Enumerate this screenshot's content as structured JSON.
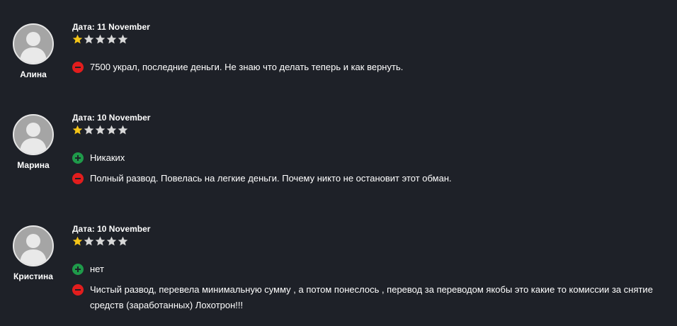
{
  "colors": {
    "background": "#1e2128",
    "star_filled": "#f5c518",
    "star_empty": "#d8d8d8",
    "minus_sign": "#e21d1d",
    "plus_sign": "#1f9a4a"
  },
  "reviews": [
    {
      "author": "Алина",
      "date": "Дата: 11 November",
      "rating": 1,
      "max_rating": 5,
      "pros": "",
      "cons": "7500 украл, последние деньги. Не знаю что делать теперь и как вернуть."
    },
    {
      "author": "Марина",
      "date": "Дата: 10 November",
      "rating": 1,
      "max_rating": 5,
      "pros": "Никаких",
      "cons": "Полный развод. Повелась на легкие деньги. Почему никто не остановит этот обман."
    },
    {
      "author": "Кристина",
      "date": "Дата: 10 November",
      "rating": 1,
      "max_rating": 5,
      "pros": "нет",
      "cons": "Чистый развод, перевела минимальную сумму , а потом понеслось , перевод за переводом якобы это какие то комиссии за снятие средств (заработанных) Лохотрон!!!"
    }
  ]
}
